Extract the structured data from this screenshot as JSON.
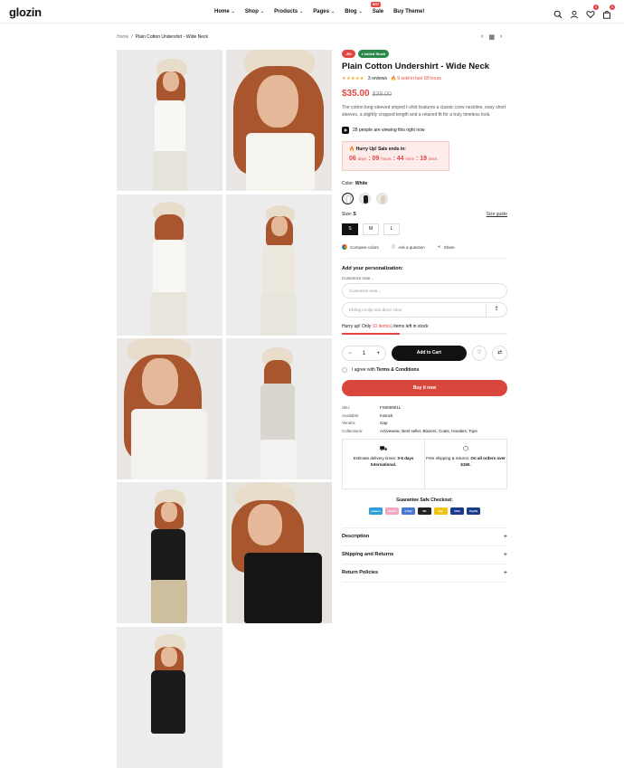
{
  "header": {
    "logo": "glozin",
    "nav": [
      {
        "label": "Home",
        "chev": "⌄"
      },
      {
        "label": "Shop",
        "chev": "⌄"
      },
      {
        "label": "Products",
        "chev": "⌄"
      },
      {
        "label": "Pages",
        "chev": "⌄"
      },
      {
        "label": "Blog",
        "chev": "⌄"
      },
      {
        "label": "Sale",
        "chev": ""
      },
      {
        "label": "Buy Theme!",
        "chev": ""
      }
    ],
    "hot_badge": "HOT",
    "wishlist_count": "0",
    "cart_count": "0"
  },
  "breadcrumb": {
    "home": "Home",
    "current": "Plain Cotton Undershirt - Wide Neck"
  },
  "product": {
    "badge_sale": "-8%",
    "badge_stock": "Limited Stock",
    "title": "Plain Cotton Undershirt - Wide Neck",
    "stars": "★★★★★",
    "reviews": "3 reviews",
    "sold": "9 sold in last 18 hours",
    "price": "$35.00",
    "old_price": "$38.00",
    "description": "The cotton long-sleeved striped t-shirt features a classic crew neckline, easy short sleeves, a slightly cropped length and a relaxed fit for a truly timeless look.",
    "viewers": "28 people are viewing this right now",
    "sale": {
      "heading": "Hurry Up! Sale ends in:",
      "days": "06",
      "days_l": "days",
      "hours": "09",
      "hours_l": "hours",
      "mins": "44",
      "mins_l": "mins",
      "secs": "19",
      "secs_l": "secs"
    },
    "color_label": "Color:",
    "color_value": "White",
    "size_label": "Size:",
    "size_value": "S",
    "size_guide": "Size guide",
    "sizes": [
      "S",
      "M",
      "L"
    ],
    "compare": "Compare colors",
    "ask": "Ask a question",
    "share": "Share",
    "personal_heading": "Add your personalization:",
    "customize_label": "Customize note...",
    "customize_placeholder": "Customize note...",
    "file_placeholder": "Không có tệp nào được chọn",
    "stock_pre": "Hurry up! Only",
    "stock_n": "10 item(s)",
    "stock_post": "items left in stock",
    "stock_level": 0.35,
    "qty": "1",
    "add_to_cart": "Add to Cart",
    "agree_pre": "I agree with",
    "agree_link": "Terms & Conditions",
    "buy_now": "Buy it now",
    "meta": [
      {
        "k": "Sku:",
        "v": "FS000901L"
      },
      {
        "k": "Available:",
        "v": "Instock"
      },
      {
        "k": "Vendor:",
        "v": "Gap"
      },
      {
        "k": "Collections:",
        "v": "Activewear, Best seller, Blazers, Coats, Hoodies, Tops"
      }
    ],
    "delivery_pre": "Estimate delivery times:",
    "delivery_bold": "3-5 days International.",
    "ship_pre": "Free shipping & returns:",
    "ship_bold": "On all orders over $150.",
    "safe_checkout": "Guarantee Safe Checkout:",
    "payments": [
      {
        "label": "amazon",
        "color": "#2d9fd8"
      },
      {
        "label": "Klarna",
        "color": "#f4a8c6"
      },
      {
        "label": "G Pay",
        "color": "#4a78d0"
      },
      {
        "label": "MC",
        "color": "#222"
      },
      {
        "label": "Pay",
        "color": "#f2c314"
      },
      {
        "label": "VISA",
        "color": "#1a3a8f"
      },
      {
        "label": "PayPal",
        "color": "#1c3d8a"
      }
    ],
    "accordion": [
      "Description",
      "Shipping and Returns",
      "Return Policies"
    ]
  },
  "colors": {
    "accent": "#e14641",
    "stock_badge": "#2b8a4b",
    "dark": "#111111"
  }
}
